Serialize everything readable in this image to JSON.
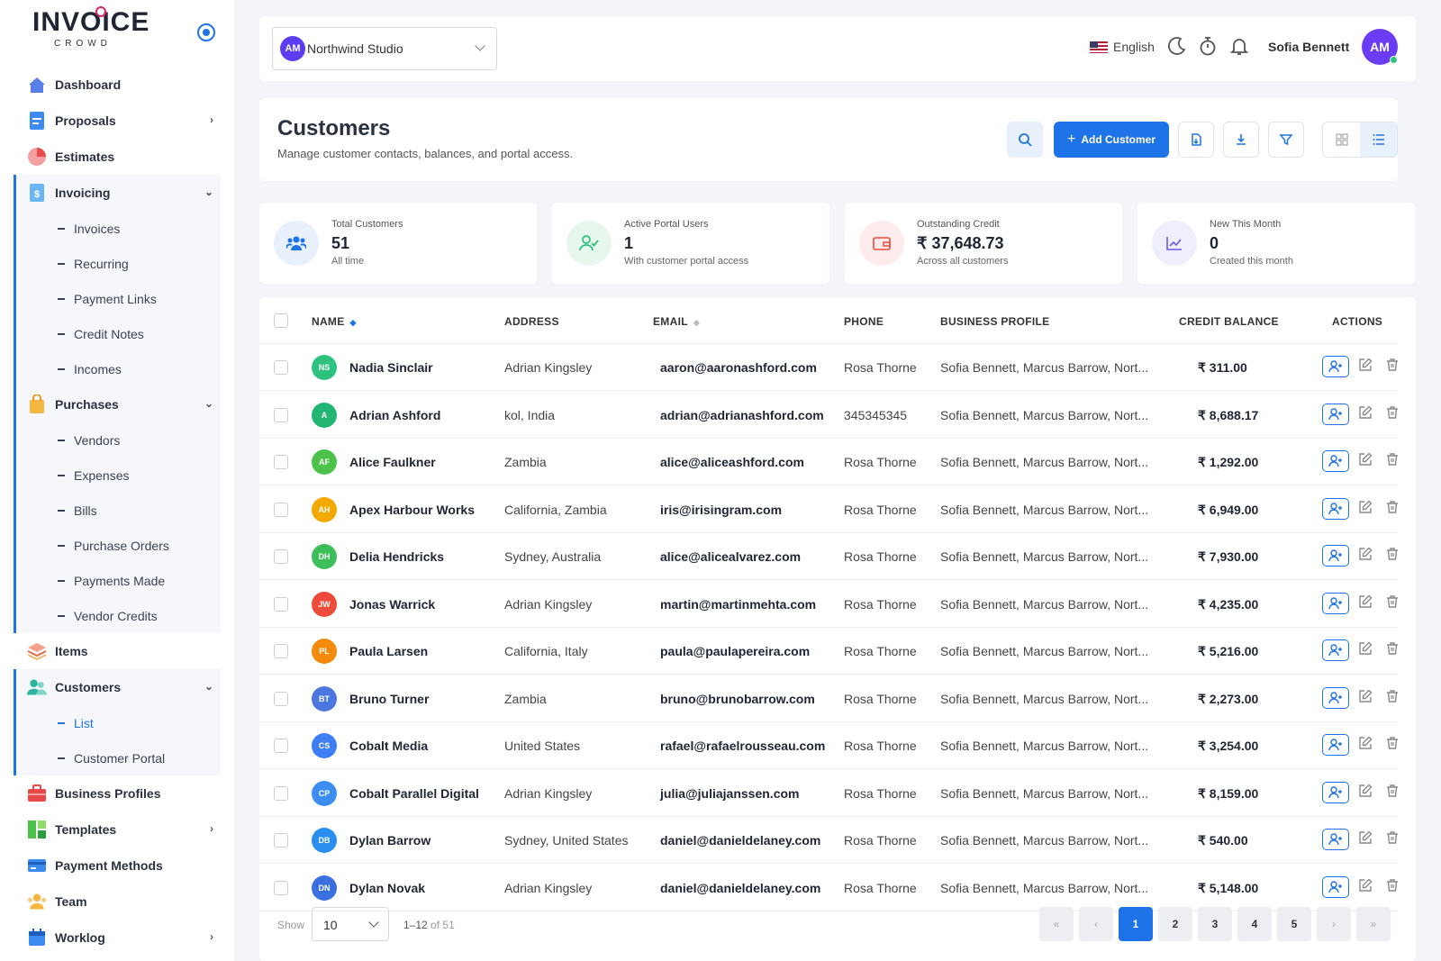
{
  "app": {
    "logo_word": "INVOICE",
    "logo_sub": "CROWD"
  },
  "sidebar": {
    "items": [
      {
        "label": "Dashboard"
      },
      {
        "label": "Proposals"
      },
      {
        "label": "Estimates"
      },
      {
        "label": "Invoicing"
      },
      {
        "label": "Purchases"
      },
      {
        "label": "Items"
      },
      {
        "label": "Customers"
      },
      {
        "label": "Business Profiles"
      },
      {
        "label": "Templates"
      },
      {
        "label": "Payment Methods"
      },
      {
        "label": "Team"
      },
      {
        "label": "Worklog"
      }
    ],
    "invoicing_sub": [
      "Invoices",
      "Recurring",
      "Payment Links",
      "Credit Notes",
      "Incomes"
    ],
    "purchases_sub": [
      "Vendors",
      "Expenses",
      "Bills",
      "Purchase Orders",
      "Payments Made",
      "Vendor Credits"
    ],
    "customers_sub": [
      "List",
      "Customer Portal"
    ]
  },
  "topbar": {
    "workspace_initials": "AM",
    "workspace_name": "Northwind Studio",
    "language": "English",
    "user_name": "Sofia Bennett",
    "user_initials": "AM"
  },
  "header": {
    "title": "Customers",
    "subtitle": "Manage customer contacts, balances, and portal access.",
    "add_label": "Add Customer"
  },
  "stats": [
    {
      "label": "Total Customers",
      "value": "51",
      "sub": "All time"
    },
    {
      "label": "Active Portal Users",
      "value": "1",
      "sub": "With customer portal access"
    },
    {
      "label": "Outstanding Credit",
      "value": "₹ 37,648.73",
      "sub": "Across all customers"
    },
    {
      "label": "New This Month",
      "value": "0",
      "sub": "Created this month"
    }
  ],
  "table": {
    "columns": [
      "NAME",
      "ADDRESS",
      "EMAIL",
      "PHONE",
      "BUSINESS PROFILE",
      "CREDIT BALANCE",
      "ACTIONS"
    ],
    "rows": [
      {
        "initials": "NS",
        "color": "#2ec27e",
        "name": "Nadia Sinclair",
        "address": "Adrian Kingsley",
        "email": "aaron@aaronashford.com",
        "phone": "Rosa Thorne",
        "profile": "Sofia Bennett, Marcus Barrow, Nort...",
        "credit": "₹ 311.00"
      },
      {
        "initials": "A",
        "color": "#22b573",
        "name": "Adrian Ashford",
        "address": "kol, India",
        "email": "adrian@adrianashford.com",
        "phone": "345345345",
        "profile": "Sofia Bennett, Marcus Barrow, Nort...",
        "credit": "₹ 8,688.17"
      },
      {
        "initials": "AF",
        "color": "#4cc24a",
        "name": "Alice Faulkner",
        "address": "Zambia",
        "email": "alice@aliceashford.com",
        "phone": "Rosa Thorne",
        "profile": "Sofia Bennett, Marcus Barrow, Nort...",
        "credit": "₹ 1,292.00"
      },
      {
        "initials": "AH",
        "color": "#f2a900",
        "name": "Apex Harbour Works",
        "address": "California, Zambia",
        "email": "iris@irisingram.com",
        "phone": "Rosa Thorne",
        "profile": "Sofia Bennett, Marcus Barrow, Nort...",
        "credit": "₹ 6,949.00"
      },
      {
        "initials": "DH",
        "color": "#3cbf5a",
        "name": "Delia Hendricks",
        "address": "Sydney, Australia",
        "email": "alice@alicealvarez.com",
        "phone": "Rosa Thorne",
        "profile": "Sofia Bennett, Marcus Barrow, Nort...",
        "credit": "₹ 7,930.00"
      },
      {
        "initials": "JW",
        "color": "#ee4b3a",
        "name": "Jonas Warrick",
        "address": "Adrian Kingsley",
        "email": "martin@martinmehta.com",
        "phone": "Rosa Thorne",
        "profile": "Sofia Bennett, Marcus Barrow, Nort...",
        "credit": "₹ 4,235.00"
      },
      {
        "initials": "PL",
        "color": "#f58b0a",
        "name": "Paula Larsen",
        "address": "California, Italy",
        "email": "paula@paulapereira.com",
        "phone": "Rosa Thorne",
        "profile": "Sofia Bennett, Marcus Barrow, Nort...",
        "credit": "₹ 5,216.00"
      },
      {
        "initials": "BT",
        "color": "#4a78e0",
        "name": "Bruno Turner",
        "address": "Zambia",
        "email": "bruno@brunobarrow.com",
        "phone": "Rosa Thorne",
        "profile": "Sofia Bennett, Marcus Barrow, Nort...",
        "credit": "₹ 2,273.00"
      },
      {
        "initials": "CS",
        "color": "#3d7ef2",
        "name": "Cobalt Media",
        "address": "United States",
        "email": "rafael@rafaelrousseau.com",
        "phone": "Rosa Thorne",
        "profile": "Sofia Bennett, Marcus Barrow, Nort...",
        "credit": "₹ 3,254.00"
      },
      {
        "initials": "CP",
        "color": "#3d8ef2",
        "name": "Cobalt Parallel Digital",
        "address": "Adrian Kingsley",
        "email": "julia@juliajanssen.com",
        "phone": "Rosa Thorne",
        "profile": "Sofia Bennett, Marcus Barrow, Nort...",
        "credit": "₹ 8,159.00"
      },
      {
        "initials": "DB",
        "color": "#2a8ef0",
        "name": "Dylan Barrow",
        "address": "Sydney, United States",
        "email": "daniel@danieldelaney.com",
        "phone": "Rosa Thorne",
        "profile": "Sofia Bennett, Marcus Barrow, Nort...",
        "credit": "₹ 540.00"
      },
      {
        "initials": "DN",
        "color": "#3a6fe0",
        "name": "Dylan Novak",
        "address": "Adrian Kingsley",
        "email": "daniel@danieldelaney.com",
        "phone": "Rosa Thorne",
        "profile": "Sofia Bennett, Marcus Barrow, Nort...",
        "credit": "₹ 5,148.00"
      }
    ]
  },
  "pagination": {
    "show_label": "Show",
    "page_size": "10",
    "range_prefix": "1–12",
    "range_of": "of 51",
    "pages": [
      "1",
      "2",
      "3",
      "4",
      "5"
    ],
    "current": "1"
  }
}
